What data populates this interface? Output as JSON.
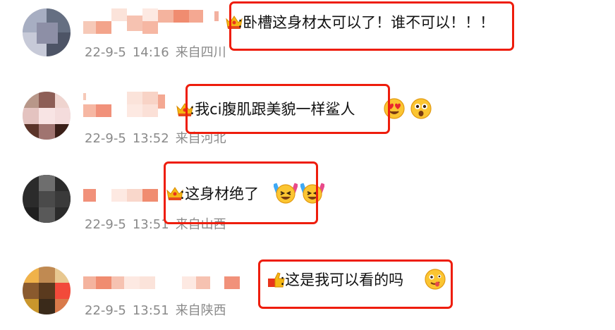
{
  "comments": [
    {
      "text": ":卧槽这身材太可以了！谁不可以！！！",
      "date": "22-9-5",
      "time": "14:16",
      "location": "来自四川",
      "emojis": []
    },
    {
      "text": ":我ci腹肌跟美貌一样鲨人",
      "date": "22-9-5",
      "time": "13:52",
      "location": "来自河北",
      "emojis": [
        "heart-eyes-emoji",
        "shocked-emoji"
      ]
    },
    {
      "text": ":这身材绝了",
      "date": "22-9-5",
      "time": "13:51",
      "location": "来自山西",
      "emojis": [
        "party-laugh-emoji",
        "party-laugh-emoji"
      ]
    },
    {
      "text": ":这是我可以看的吗",
      "date": "22-9-5",
      "time": "13:51",
      "location": "来自陕西",
      "emojis": [
        "tongue-out-emoji"
      ]
    }
  ],
  "colors": {
    "highlight": "#ee1d0c",
    "meta_text": "#8a8a8a",
    "body_text": "#111111",
    "username_mosaic": "#f29a80"
  }
}
